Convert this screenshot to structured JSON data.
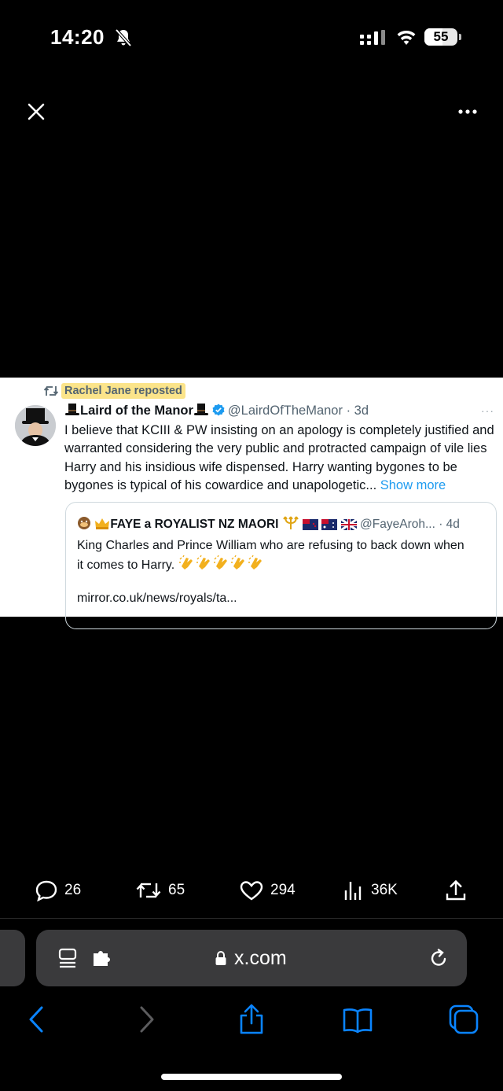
{
  "status_bar": {
    "time": "14:20",
    "battery": "55",
    "battery_level": 0.55,
    "icons": [
      "bell-slash-icon",
      "signal-icon",
      "wifi-icon",
      "battery-icon"
    ]
  },
  "viewer": {
    "close_icon": "close-icon",
    "more_icon": "more-icon"
  },
  "tweet": {
    "repost_label": "Rachel Jane reposted",
    "author_name": "Laird of the Manor",
    "author_handle": "@LairdOfTheManor · 3d",
    "more": "···",
    "text": "I believe that KCIII & PW insisting on an apology is completely justified and warranted considering the very public and protracted campaign of vile lies Harry and his insidious wife dispensed. Harry wanting bygones to be bygones is typical of his cowardice and unapologetic... ",
    "show_more": "Show more",
    "quote": {
      "name": "FAYE a ROYALIST NZ MAORI",
      "handle": "@FayeAroh... · 4d",
      "text": "King Charles and Prince William who are refusing to back down when it comes to Harry.",
      "link": "mirror.co.uk/news/royals/ta..."
    }
  },
  "actions": {
    "replies": "26",
    "reposts": "65",
    "likes": "294",
    "views": "36K"
  },
  "safari": {
    "url": "x.com",
    "colors": {
      "accent": "#0a84ff",
      "disabled": "#5c5c5e",
      "bar": "#3a3a3c"
    }
  },
  "colors": {
    "link": "#1d9bf0",
    "verified": "#1d9bf0",
    "highlight": "#fbe48a",
    "secondary_text": "#536471"
  }
}
